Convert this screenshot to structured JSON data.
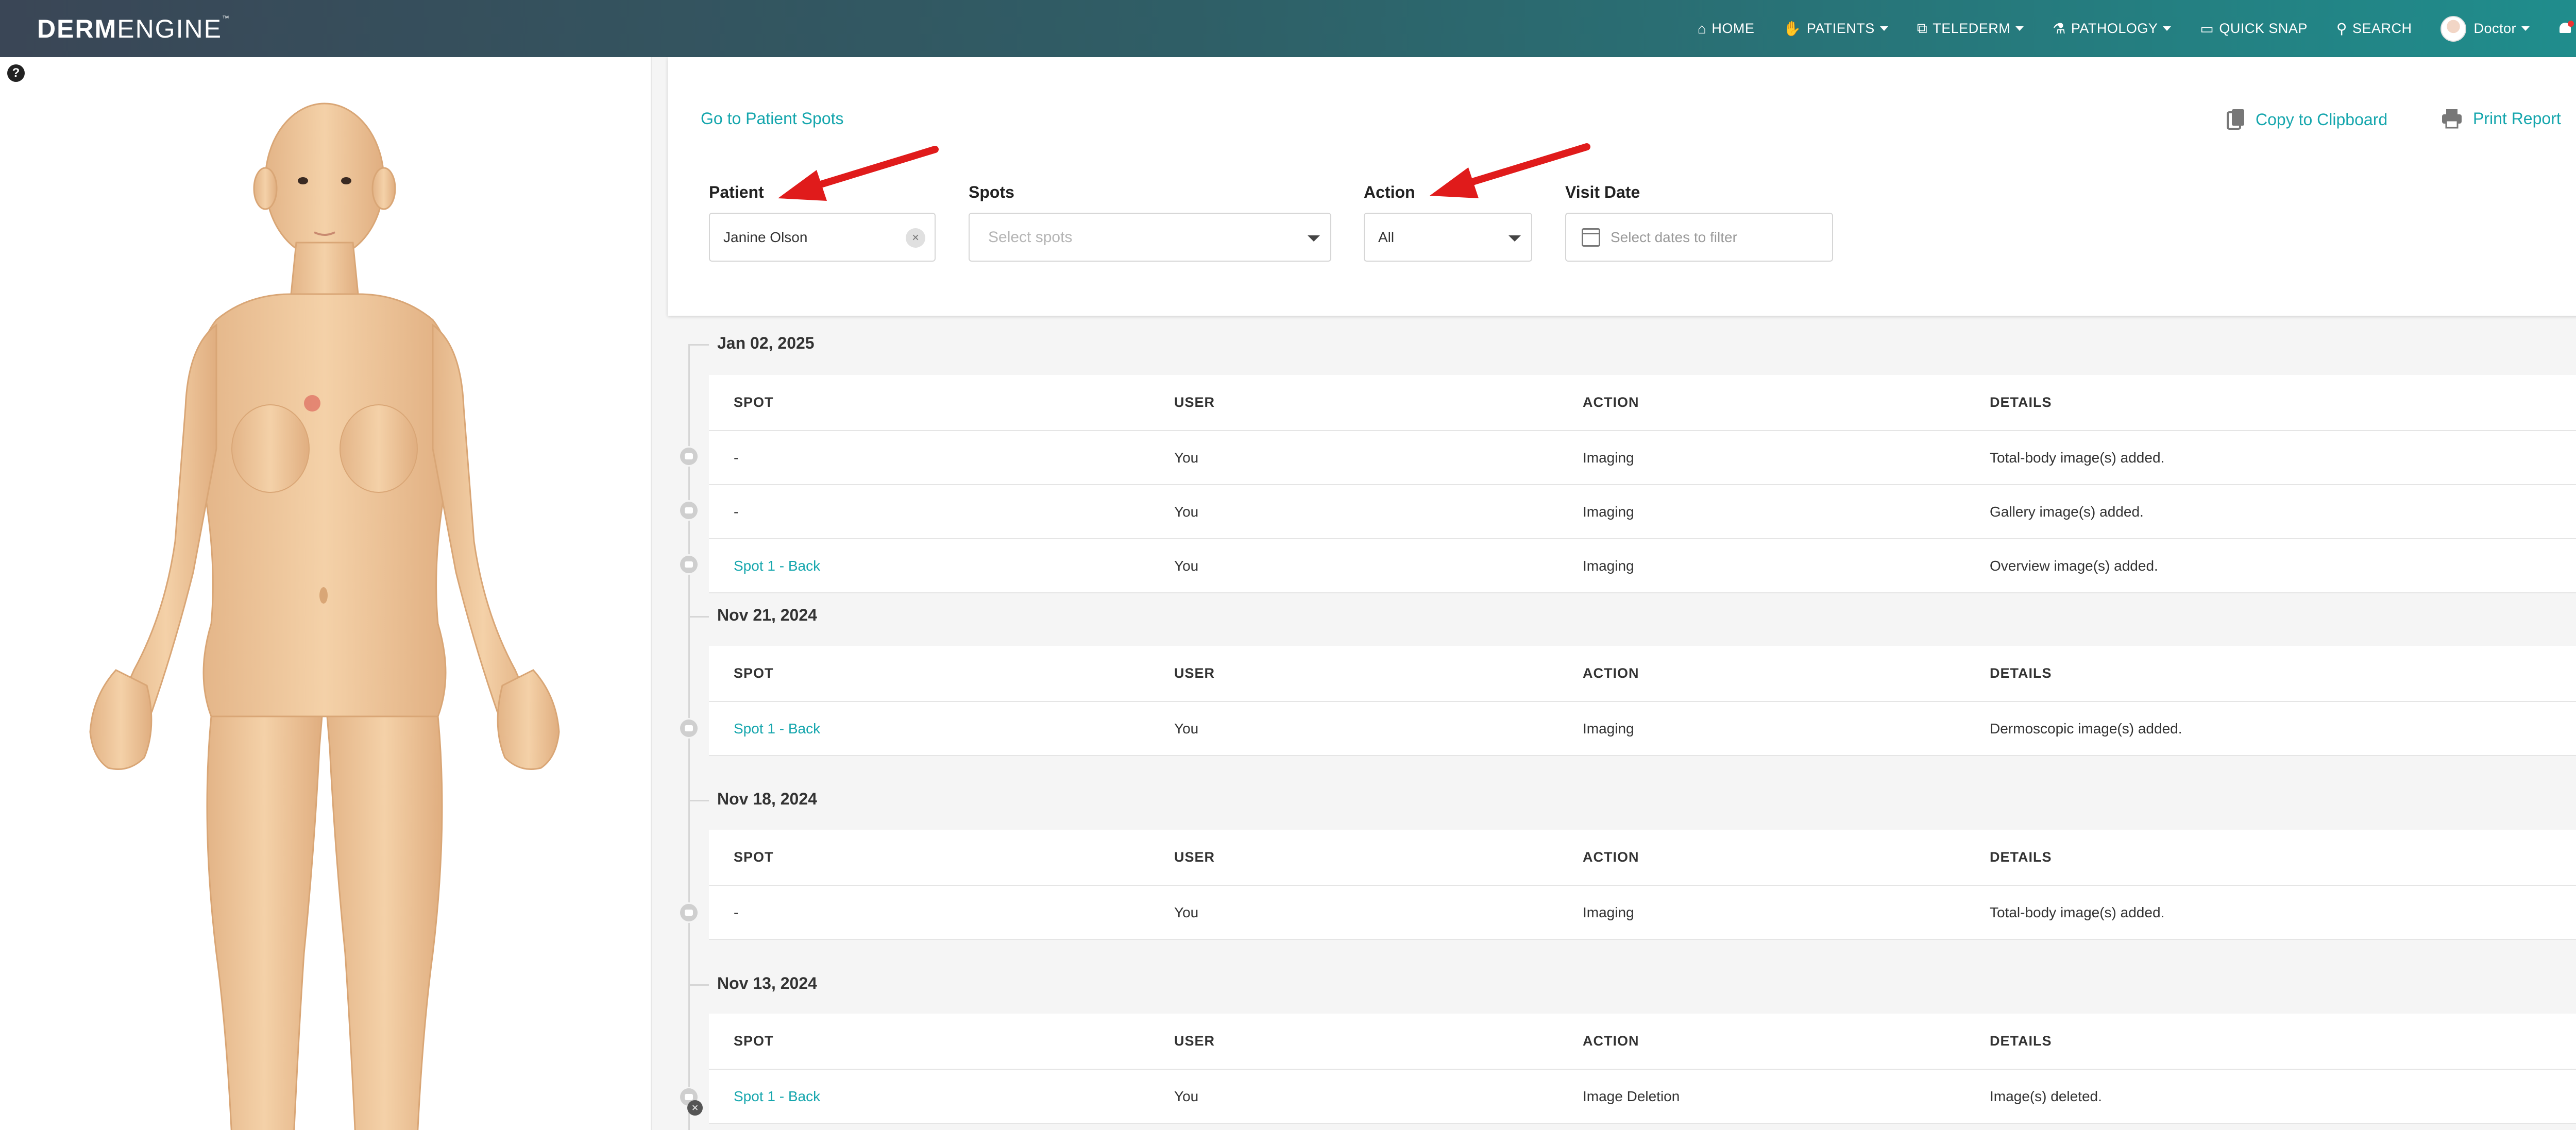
{
  "nav": {
    "logo_bold": "DERM",
    "logo_thin": "ENGINE",
    "logo_tm": "™",
    "items": [
      {
        "label": "HOME",
        "icon": "home-icon",
        "dropdown": false
      },
      {
        "label": "PATIENTS",
        "icon": "patients-icon",
        "dropdown": true
      },
      {
        "label": "TELEDERM",
        "icon": "telederm-icon",
        "dropdown": true
      },
      {
        "label": "PATHOLOGY",
        "icon": "pathology-icon",
        "dropdown": true
      },
      {
        "label": "QUICK SNAP",
        "icon": "quick-snap-icon",
        "dropdown": false
      },
      {
        "label": "SEARCH",
        "icon": "search-icon",
        "dropdown": false
      }
    ],
    "user_label": "Doctor",
    "help": "?"
  },
  "body_panel": {
    "help": "?",
    "marked_spot_color": "#e07a6a"
  },
  "filters": {
    "goto_link": "Go to Patient Spots",
    "copy_label": "Copy to Clipboard",
    "print_label": "Print Report",
    "patient_label": "Patient",
    "patient_value": "Janine Olson",
    "spots_label": "Spots",
    "spots_placeholder": "Select spots",
    "action_label": "Action",
    "action_value": "All",
    "visit_label": "Visit Date",
    "visit_placeholder": "Select dates to filter"
  },
  "columns": {
    "spot": "SPOT",
    "user": "USER",
    "action": "ACTION",
    "details": "DETAILS"
  },
  "groups": [
    {
      "date": "Jan 02, 2025",
      "rows": [
        {
          "spot": "-",
          "spot_link": false,
          "user": "You",
          "action": "Imaging",
          "details": "Total-body image(s) added."
        },
        {
          "spot": "-",
          "spot_link": false,
          "user": "You",
          "action": "Imaging",
          "details": "Gallery image(s) added."
        },
        {
          "spot": "Spot 1 - Back",
          "spot_link": true,
          "user": "You",
          "action": "Imaging",
          "details": "Overview image(s) added."
        }
      ]
    },
    {
      "date": "Nov 21, 2024",
      "rows": [
        {
          "spot": "Spot 1 - Back",
          "spot_link": true,
          "user": "You",
          "action": "Imaging",
          "details": "Dermoscopic image(s) added."
        }
      ]
    },
    {
      "date": "Nov 18, 2024",
      "rows": [
        {
          "spot": "-",
          "spot_link": false,
          "user": "You",
          "action": "Imaging",
          "details": "Total-body image(s) added."
        }
      ]
    },
    {
      "date": "Nov 13, 2024",
      "rows": [
        {
          "spot": "Spot 1 - Back",
          "spot_link": true,
          "user": "You",
          "action": "Image Deletion",
          "details": "Image(s) deleted."
        }
      ]
    }
  ],
  "colors": {
    "accent": "#15a6ad",
    "arrow": "#e01b1b"
  }
}
